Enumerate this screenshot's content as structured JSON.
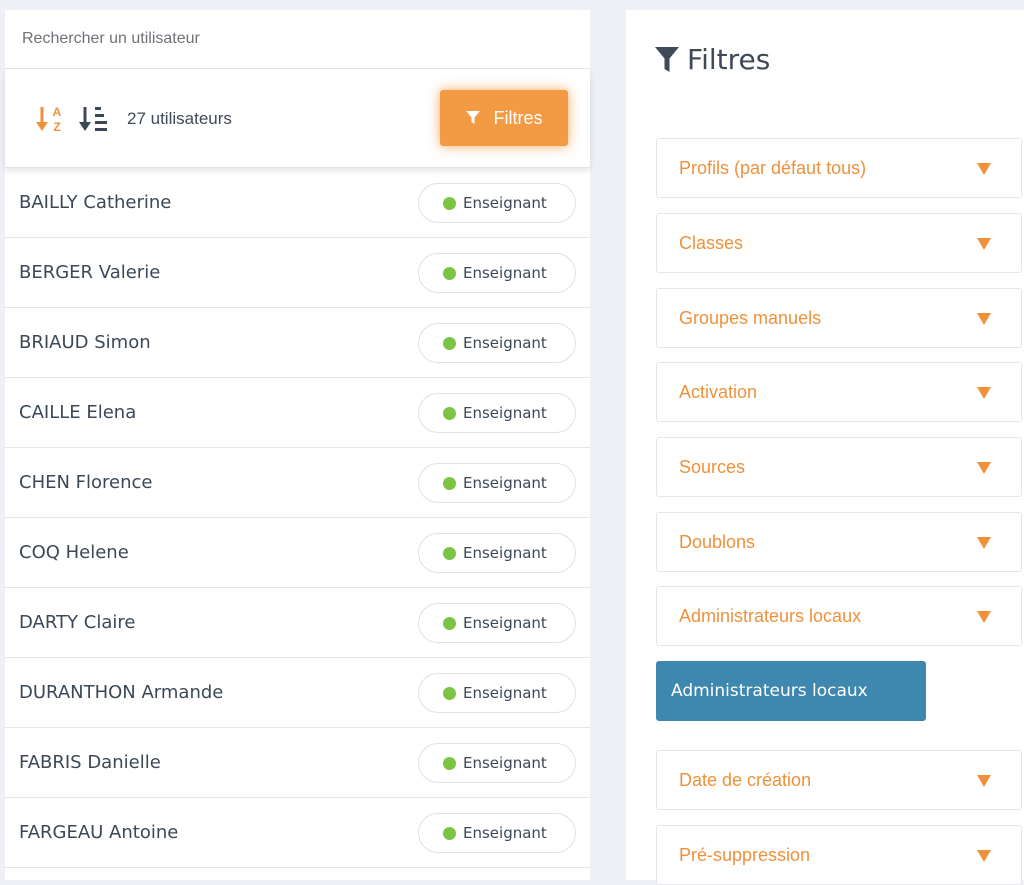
{
  "search": {
    "placeholder": "Rechercher un utilisateur"
  },
  "toolbar": {
    "user_count": "27 utilisateurs",
    "filters_button_label": "Filtres"
  },
  "users": [
    {
      "name": "BAILLY Catherine",
      "role": "Enseignant",
      "status_color": "#7cc444"
    },
    {
      "name": "BERGER Valerie",
      "role": "Enseignant",
      "status_color": "#7cc444"
    },
    {
      "name": "BRIAUD Simon",
      "role": "Enseignant",
      "status_color": "#7cc444"
    },
    {
      "name": "CAILLE Elena",
      "role": "Enseignant",
      "status_color": "#7cc444"
    },
    {
      "name": "CHEN Florence",
      "role": "Enseignant",
      "status_color": "#7cc444"
    },
    {
      "name": "COQ Helene",
      "role": "Enseignant",
      "status_color": "#7cc444"
    },
    {
      "name": "DARTY Claire",
      "role": "Enseignant",
      "status_color": "#7cc444"
    },
    {
      "name": "DURANTHON Armande",
      "role": "Enseignant",
      "status_color": "#7cc444"
    },
    {
      "name": "FABRIS Danielle",
      "role": "Enseignant",
      "status_color": "#7cc444"
    },
    {
      "name": "FARGEAU Antoine",
      "role": "Enseignant",
      "status_color": "#7cc444"
    }
  ],
  "filters_panel": {
    "title": "Filtres",
    "sections": [
      {
        "label": "Profils (par défaut tous)"
      },
      {
        "label": "Classes"
      },
      {
        "label": "Groupes manuels"
      },
      {
        "label": "Activation"
      },
      {
        "label": "Sources"
      },
      {
        "label": "Doublons"
      },
      {
        "label": "Administrateurs locaux"
      },
      {
        "label": "Date de création"
      },
      {
        "label": "Pré-suppression"
      }
    ],
    "selected_chip": "Administrateurs locaux"
  },
  "colors": {
    "accent_orange": "#f39a45",
    "filter_label_orange": "#f0913a",
    "chip_blue": "#3e88b0",
    "status_green": "#7cc444",
    "text_dark": "#3c4855"
  },
  "icons": {
    "sort_alpha": "sort-alpha-down-icon",
    "sort_list": "sort-amount-down-icon",
    "funnel": "filter-funnel-icon",
    "chevron": "caret-down-icon"
  }
}
